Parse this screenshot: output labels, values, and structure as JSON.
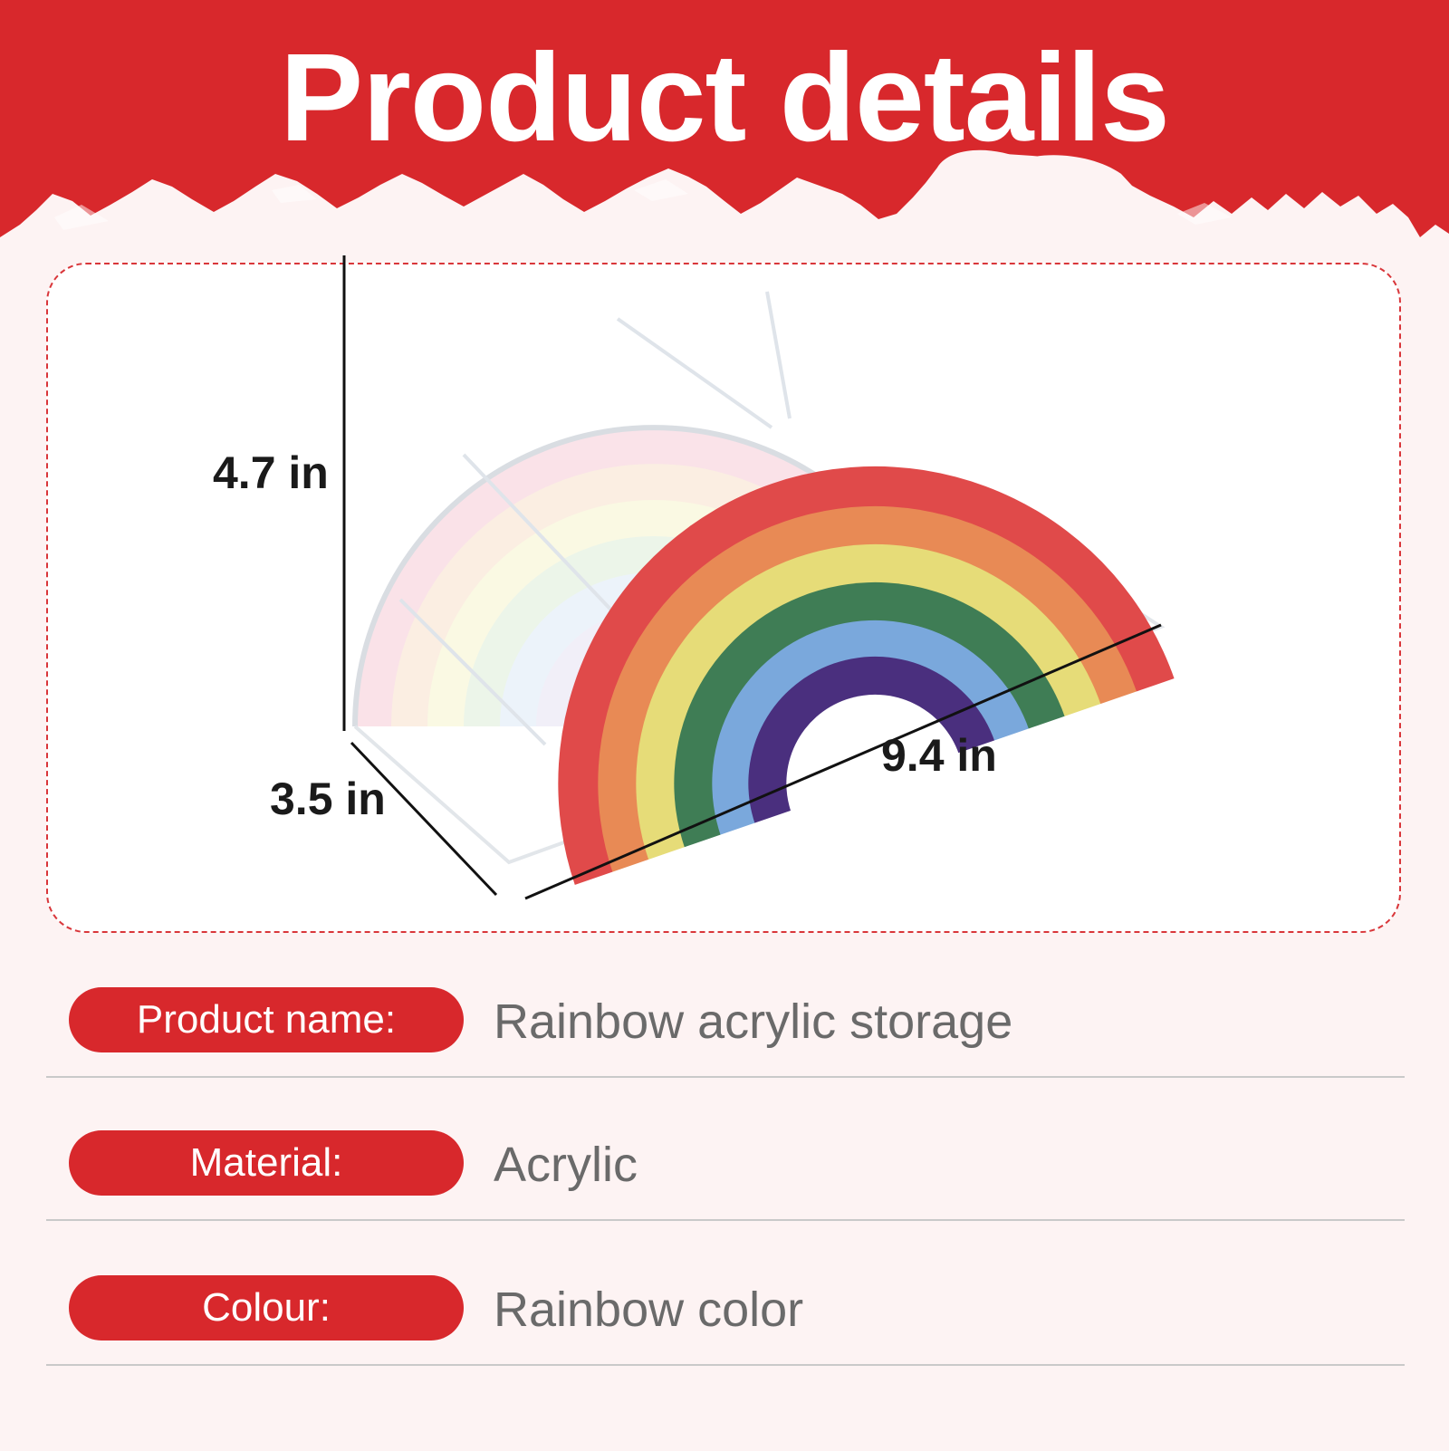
{
  "header": {
    "title": "Product details"
  },
  "dimensions": {
    "height": "4.7 in",
    "depth": "3.5 in",
    "width": "9.4 in"
  },
  "specs": [
    {
      "label": "Product name:",
      "value": "Rainbow acrylic storage"
    },
    {
      "label": "Material:",
      "value": "Acrylic"
    },
    {
      "label": "Colour:",
      "value": "Rainbow color"
    }
  ],
  "colors": {
    "accent": "#d8282c",
    "background": "#fdf3f3",
    "rainbow": [
      "#e04a4a",
      "#e88a55",
      "#e6dc78",
      "#3f7d55",
      "#7aa8dc",
      "#4a2f7e"
    ]
  }
}
